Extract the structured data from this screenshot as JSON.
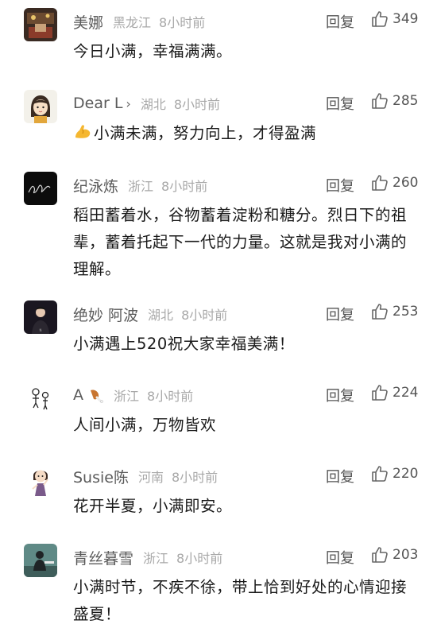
{
  "reply_label": "回复",
  "comments": [
    {
      "name": "美娜",
      "location": "黑龙江",
      "time": "8小时前",
      "likes": "349",
      "text": "今日小满，幸福满满。",
      "avatar": "photo-dark-room"
    },
    {
      "name": "Dear L",
      "location": "湖北",
      "time": "8小时前",
      "likes": "285",
      "text": "小满未满，努力向上，才得盈满",
      "leading_emoji": "flexed-biceps-icon",
      "avatar": "cartoon-girl"
    },
    {
      "name": "纪泳炼",
      "location": "浙江",
      "time": "8小时前",
      "likes": "260",
      "text": "稻田蓄着水，谷物蓄着淀粉和糖分。烈日下的祖辈，蓄着托起下一代的力量。这就是我对小满的理解。",
      "avatar": "black-signature"
    },
    {
      "name": "绝妙 阿波",
      "location": "湖北",
      "time": "8小时前",
      "likes": "253",
      "text": "小满遇上520祝大家幸福美满！",
      "avatar": "portrait-dark"
    },
    {
      "name": "A",
      "location": "浙江",
      "time": "8小时前",
      "likes": "224",
      "text": "人间小满，万物皆欢",
      "name_emoji": "drumstick-icon",
      "avatar": "doodle-figures"
    },
    {
      "name": "Susie陈",
      "location": "河南",
      "time": "8小时前",
      "likes": "220",
      "text": "花开半夏，小满即安。",
      "avatar": "cartoon-girl-pose"
    },
    {
      "name": "青丝暮雪",
      "location": "浙江",
      "time": "8小时前",
      "likes": "203",
      "text": "小满时节，不疾不徐，带上恰到好处的心情迎接盛夏！",
      "avatar": "photo-teal-portrait"
    }
  ]
}
